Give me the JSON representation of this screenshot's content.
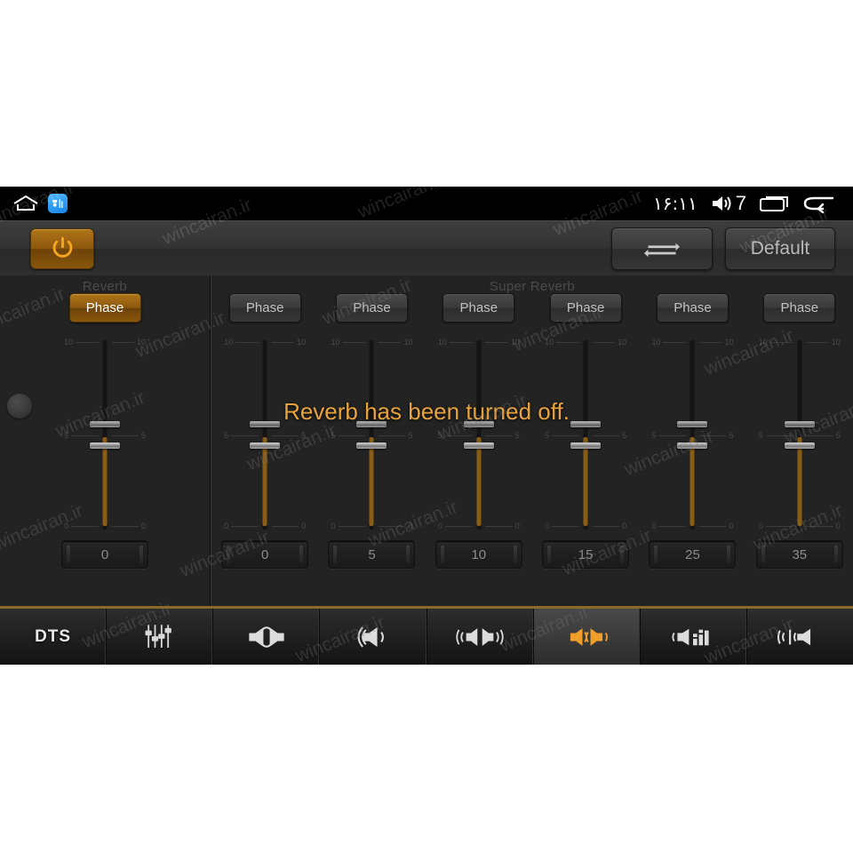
{
  "statusbar": {
    "home_icon": "home-icon",
    "app_icon": "app-icon",
    "clock": "۱۶:۱۱",
    "volume_icon": "volume-icon",
    "volume_level": "7",
    "recents_icon": "recents-icon",
    "back_icon": "back-icon"
  },
  "toolbar": {
    "power_icon": "power-icon",
    "swap_icon": "swap-arrows-icon",
    "default_label": "Default"
  },
  "content": {
    "left_panel": {
      "title": "Reverb",
      "knob": "level-knob",
      "strip": {
        "phase_label": "Phase",
        "phase_on": true,
        "value": "0",
        "ticks": [
          "10",
          "5",
          "0"
        ]
      }
    },
    "right_panel": {
      "title": "Super Reverb",
      "strips": [
        {
          "phase_label": "Phase",
          "phase_on": false,
          "value": "0",
          "ticks": [
            "10",
            "5",
            "0"
          ]
        },
        {
          "phase_label": "Phase",
          "phase_on": false,
          "value": "5",
          "ticks": [
            "10",
            "5",
            "0"
          ]
        },
        {
          "phase_label": "Phase",
          "phase_on": false,
          "value": "10",
          "ticks": [
            "10",
            "5",
            "0"
          ]
        },
        {
          "phase_label": "Phase",
          "phase_on": false,
          "value": "15",
          "ticks": [
            "10",
            "5",
            "0"
          ]
        },
        {
          "phase_label": "Phase",
          "phase_on": false,
          "value": "25",
          "ticks": [
            "10",
            "5",
            "0"
          ]
        },
        {
          "phase_label": "Phase",
          "phase_on": false,
          "value": "35",
          "ticks": [
            "10",
            "5",
            "0"
          ]
        }
      ]
    },
    "toast": "Reverb has been turned off."
  },
  "tabbar": {
    "active_index": 5,
    "tabs": [
      {
        "label": "DTS",
        "icon": "dts-text-icon"
      },
      {
        "label": "",
        "icon": "equalizer-sliders-icon"
      },
      {
        "label": "",
        "icon": "stereo-balance-icon"
      },
      {
        "label": "",
        "icon": "speaker-waves-icon"
      },
      {
        "label": "",
        "icon": "surround-speakers-icon"
      },
      {
        "label": "",
        "icon": "dual-speaker-active-icon"
      },
      {
        "label": "",
        "icon": "speaker-bars-icon"
      },
      {
        "label": "",
        "icon": "speaker-signal-icon"
      }
    ]
  },
  "colors": {
    "accent": "#e8a33d",
    "accent_button": "#8c580d",
    "panel_bg": "#232323",
    "app_bg": "#000000",
    "tab_rule": "#8a6a24"
  },
  "watermark": {
    "text": "wincairan.ir"
  }
}
